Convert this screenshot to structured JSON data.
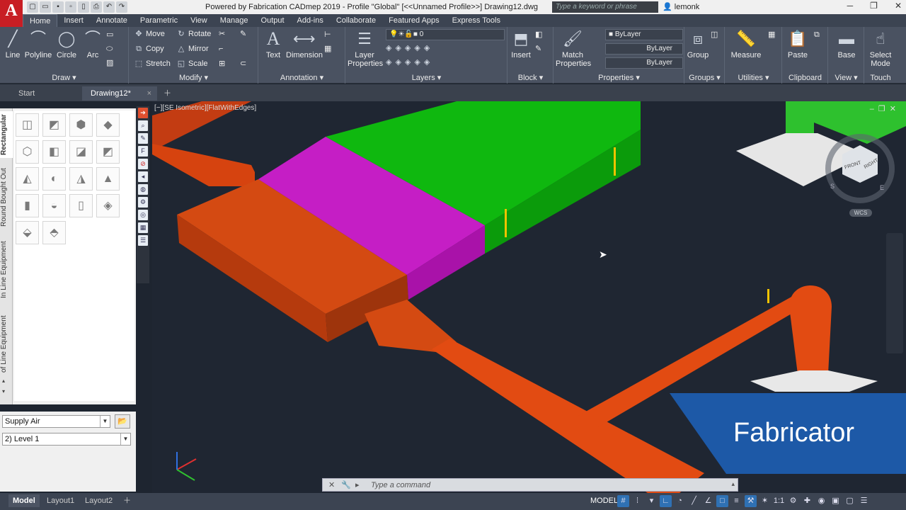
{
  "app": {
    "logo": "A",
    "title": "Powered by Fabrication CADmep 2019 - Profile \"Global\"  [<<Unnamed Profile>>]      Drawing12.dwg",
    "search_placeholder": "Type a keyword or phrase",
    "user": "lemonk"
  },
  "ribbon_tabs": [
    "Home",
    "Insert",
    "Annotate",
    "Parametric",
    "View",
    "Manage",
    "Output",
    "Add-ins",
    "Collaborate",
    "Featured Apps",
    "Express Tools"
  ],
  "panels": {
    "draw": {
      "title": "Draw",
      "line": "Line",
      "polyline": "Polyline",
      "circle": "Circle",
      "arc": "Arc"
    },
    "modify": {
      "title": "Modify",
      "move": "Move",
      "rotate": "Rotate",
      "copy": "Copy",
      "mirror": "Mirror",
      "stretch": "Stretch",
      "scale": "Scale"
    },
    "annotation": {
      "title": "Annotation",
      "text": "Text",
      "dimension": "Dimension"
    },
    "layers": {
      "title": "Layers",
      "layer_properties": "Layer Properties",
      "current_layer": "0"
    },
    "block": {
      "title": "Block",
      "insert": "Insert"
    },
    "properties": {
      "title": "Properties",
      "match": "Match Properties",
      "color": "ByLayer",
      "linetype": "ByLayer",
      "lineweight": "ByLayer"
    },
    "groups": {
      "title": "Groups",
      "group": "Group"
    },
    "utilities": {
      "title": "Utilities",
      "measure": "Measure"
    },
    "clipboard": {
      "title": "Clipboard",
      "paste": "Paste"
    },
    "view": {
      "title": "View",
      "base": "Base"
    },
    "touch": {
      "title": "Touch",
      "select_mode": "Select Mode"
    }
  },
  "doc_tabs": [
    "Start",
    "Drawing12*"
  ],
  "viewport": {
    "label": "[−][SE Isometric][FlatWithEdges]",
    "wcs": "WCS",
    "cube_front": "FRONT",
    "cube_right": "RIGHT",
    "compass_s": "S",
    "compass_e": "E"
  },
  "palette": {
    "tabs": [
      "Rectangular",
      "Round Bought Out",
      "In Line Equipment",
      "of Line Equipment"
    ],
    "service": "Supply Air",
    "level": "2) Level 1"
  },
  "command": {
    "placeholder": "Type a command"
  },
  "layout_tabs": [
    "Model",
    "Layout1",
    "Layout2"
  ],
  "status": {
    "model": "MODEL",
    "scale": "1:1"
  },
  "brand": {
    "text": "Fabricator",
    "color": "#1d59a7"
  }
}
